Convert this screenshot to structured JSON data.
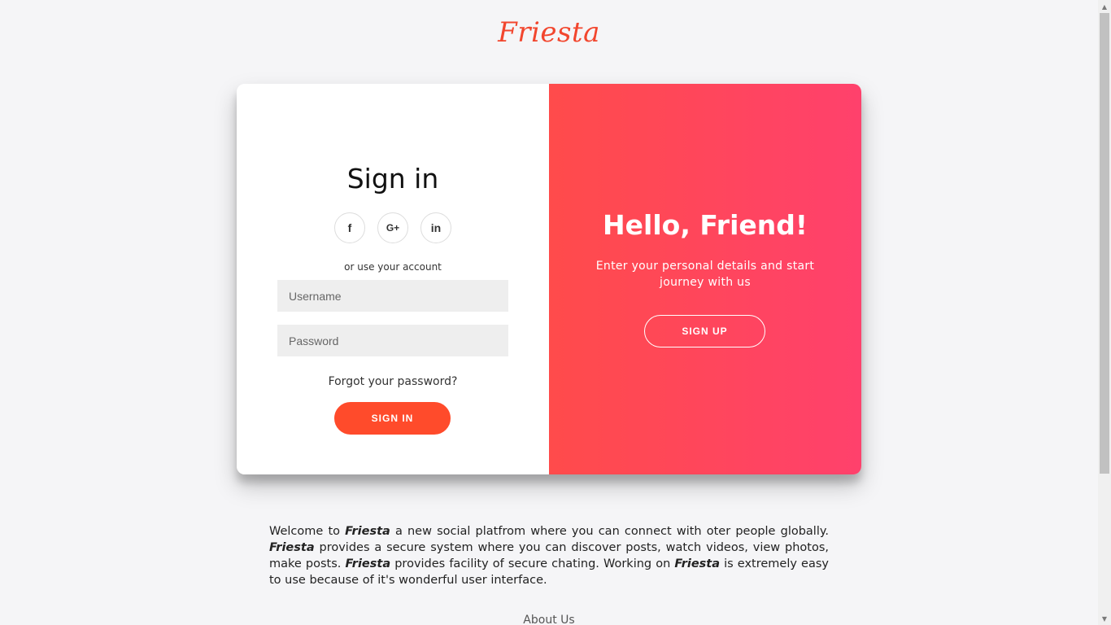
{
  "brand": {
    "logo": "Friesta"
  },
  "signin": {
    "title": "Sign in",
    "socials": [
      {
        "icon": "facebook-icon",
        "glyph": "f"
      },
      {
        "icon": "google-plus-icon",
        "glyph": "G+"
      },
      {
        "icon": "linkedin-icon",
        "glyph": "in"
      }
    ],
    "alt_text": "or use your account",
    "username_placeholder": "Username",
    "password_placeholder": "Password",
    "forgot": "Forgot your password?",
    "button": "SIGN IN"
  },
  "overlay": {
    "title": "Hello, Friend!",
    "text": "Enter your personal details and start journey with us",
    "button": "SIGN UP"
  },
  "welcome": {
    "part1": "Welcome to ",
    "brand1": "Friesta",
    "part2": " a new social platfrom where you can connect with oter people globally. ",
    "brand2": "Friesta",
    "part3": " provides a secure system where you can discover posts, watch videos, view photos, make posts. ",
    "brand3": "Friesta",
    "part4": " provides facility of secure chating. Working on ",
    "brand4": "Friesta",
    "part5": " is extremely easy to use because of it's wonderful user interface."
  },
  "footer": {
    "about": "About Us"
  },
  "colors": {
    "brand": "#f2462e",
    "gradient_start": "#ff4b4b",
    "gradient_end": "#ff416c",
    "signin_button": "#ff4b2b"
  }
}
